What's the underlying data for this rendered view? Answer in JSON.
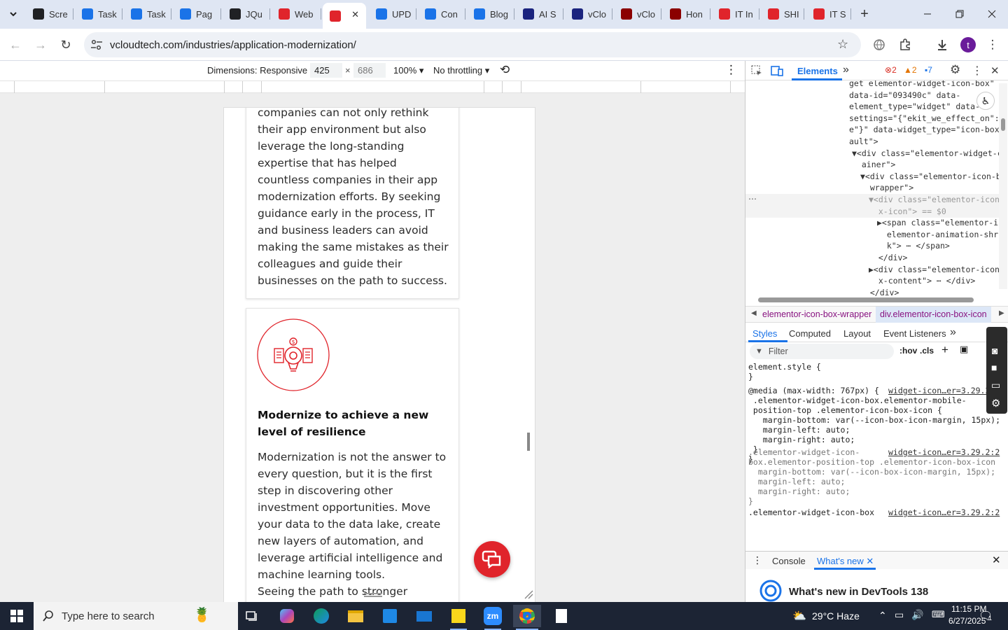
{
  "browser": {
    "tabs": [
      {
        "label": "Scre",
        "color": "#202124"
      },
      {
        "label": "Task",
        "color": "#1a73e8"
      },
      {
        "label": "Task",
        "color": "#1a73e8"
      },
      {
        "label": "Pag",
        "color": "#1a73e8"
      },
      {
        "label": "JQu",
        "color": "#202124"
      },
      {
        "label": "Web",
        "color": "#e0242b"
      },
      {
        "label": "",
        "color": "#e0242b"
      },
      {
        "label": "UPD",
        "color": "#1a73e8"
      },
      {
        "label": "Con",
        "color": "#1a73e8"
      },
      {
        "label": "Blog",
        "color": "#1a73e8"
      },
      {
        "label": "AI S",
        "color": "#1a237e"
      },
      {
        "label": "vClo",
        "color": "#1a237e"
      },
      {
        "label": "vClo",
        "color": "#8b0000"
      },
      {
        "label": "Hon",
        "color": "#8b0000"
      },
      {
        "label": "IT In",
        "color": "#e0242b"
      },
      {
        "label": "SHI",
        "color": "#e0242b"
      },
      {
        "label": "IT S",
        "color": "#e0242b"
      }
    ],
    "close_tab_glyph": "✕",
    "new_tab_glyph": "+",
    "url": "vcloudtech.com/industries/application-modernization/",
    "profile_initial": "t"
  },
  "device_toolbar": {
    "dimensions_label": "Dimensions: Responsive",
    "width": "425",
    "times": "×",
    "height": "686",
    "zoom": "100%",
    "throttling": "No throttling"
  },
  "page": {
    "card1_text": "companies can not only rethink\ntheir app environment but also\nleverage the long-standing\nexpertise that has helped\ncountless companies in their app\nmodernization efforts. By seeking\nguidance early in the process, IT\nand business leaders can avoid\nmaking the same mistakes as their\ncolleagues and guide their\nbusinesses on the path to success.",
    "card2_title": "Modernize to achieve a new level of resilience",
    "card2_text": "Modernization is not the answer to\nevery question, but it is the first\nstep in discovering other\ninvestment opportunities. Move\nyour data to the data lake, create\nnew layers of automation, and\nleverage artificial intelligence and\nmachine learning tools.\nSeeing the path to stronger"
  },
  "devtools": {
    "active_tab": "Elements",
    "more_glyph": "»",
    "errors": "2",
    "warnings": "2",
    "messages": "7",
    "dom_lines": [
      {
        "indent": 0,
        "html": "get elementor-widget-icon-box\""
      },
      {
        "indent": 0,
        "html": "data-id=\"093490c\" data-"
      },
      {
        "indent": 0,
        "html": "element_type=\"widget\" data-"
      },
      {
        "indent": 0,
        "html": "settings=\"{\"ekit_we_effect_on\":\""
      },
      {
        "indent": 0,
        "html": "e\"}\" data-widget_type=\"icon-box."
      },
      {
        "indent": 0,
        "html": "ault\">"
      },
      {
        "indent": 1,
        "html": "▼<div class=\"elementor-widget-co"
      },
      {
        "indent": 1,
        "html": "  ainer\">"
      },
      {
        "indent": 2,
        "html": "▼<div class=\"elementor-icon-bo"
      },
      {
        "indent": 2,
        "html": "  wrapper\">"
      },
      {
        "indent": 3,
        "html": "▼<div class=\"elementor-icon-"
      },
      {
        "indent": 3,
        "html": "  x-icon\"> == $0"
      },
      {
        "indent": 4,
        "html": "▶<span class=\"elementor-ic"
      },
      {
        "indent": 4,
        "html": "  elementor-animation-shrin"
      },
      {
        "indent": 4,
        "html": "  k\"> ⋯ </span>"
      },
      {
        "indent": 3,
        "html": "  </div>"
      },
      {
        "indent": 3,
        "html": "▶<div class=\"elementor-icon-"
      },
      {
        "indent": 3,
        "html": "  x-content\"> ⋯ </div>"
      },
      {
        "indent": 2,
        "html": "  </div>"
      }
    ],
    "breadcrumbs": [
      "elementor-icon-box-wrapper",
      "div.elementor-icon-box-icon"
    ],
    "styles_tabs": [
      "Styles",
      "Computed",
      "Layout",
      "Event Listeners"
    ],
    "filter_placeholder": "Filter",
    "hov": ":hov",
    "cls": ".cls",
    "css_rules": [
      {
        "text": "element.style {\n}"
      },
      {
        "text": "@media (max-width: 767px) {\n .elementor-widget-icon-box.elementor-mobile-\n position-top .elementor-icon-box-icon {\n   margin-bottom: var(--icon-box-icon-margin, 15px);\n   margin-left: auto;\n   margin-right: auto;\n }\n}"
      },
      {
        "text": ".elementor-widget-icon-\nbox.elementor-position-top .elementor-icon-box-icon {\n  margin-bottom: var(--icon-box-icon-margin, 15px);\n  margin-left: auto;\n  margin-right: auto;\n}"
      },
      {
        "text": ".elementor-widget-icon-box"
      }
    ],
    "css_source": "widget-icon…er=3.29.2:2",
    "drawer_tabs": [
      "Console",
      "What's new"
    ],
    "whats_new_title": "What's new in DevTools 138"
  },
  "taskbar": {
    "search_placeholder": "Type here to search",
    "weather": "29°C  Haze",
    "time": "11:15 PM",
    "date": "6/27/2025",
    "notifications": "1"
  }
}
